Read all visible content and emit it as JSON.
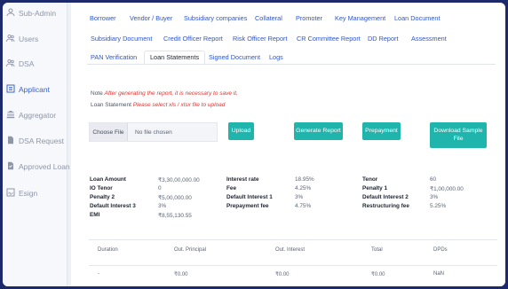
{
  "sidebar": {
    "items": [
      {
        "label": "Sub-Admin",
        "icon": "user-group-icon",
        "active": false
      },
      {
        "label": "Users",
        "icon": "users-icon",
        "active": false
      },
      {
        "label": "DSA",
        "icon": "users-icon",
        "active": false
      },
      {
        "label": "Applicant",
        "icon": "document-list-icon",
        "active": true
      },
      {
        "label": "Aggregator",
        "icon": "bank-icon",
        "active": false
      },
      {
        "label": "DSA Request",
        "icon": "file-icon",
        "active": false
      },
      {
        "label": "Approved Loan",
        "icon": "file-check-icon",
        "active": false
      },
      {
        "label": "Esign",
        "icon": "signature-icon",
        "active": false
      }
    ]
  },
  "tabs": [
    {
      "label": "Borrower"
    },
    {
      "label": "Vendor / Buyer"
    },
    {
      "label": "Subsidiary companies"
    },
    {
      "label": "Collateral"
    },
    {
      "label": "Promoter"
    },
    {
      "label": "Key Management"
    },
    {
      "label": "Loan Document"
    },
    {
      "label": "Subsidiary Document"
    },
    {
      "label": "Credit Officer Report"
    },
    {
      "label": "Risk Officer Report"
    },
    {
      "label": "CR Committee Report"
    },
    {
      "label": "DD Report"
    },
    {
      "label": "Assessment"
    },
    {
      "label": "PAN Verification"
    },
    {
      "label": "Loan Statements"
    },
    {
      "label": "Signed Document"
    },
    {
      "label": "Logs"
    }
  ],
  "active_tab": "Loan Statements",
  "notes": {
    "note_label": "Note",
    "note_text": "After generating the report, it is necessary to save it.",
    "statement_label": "Loan Statement",
    "statement_text": "Please select xls / xlsx file to upload"
  },
  "file_input": {
    "button": "Choose File",
    "status": "No file chosen"
  },
  "buttons": {
    "upload": "Upload",
    "generate": "Generate Report",
    "prepayment": "Prepayment",
    "download": "Download Sample File"
  },
  "loan_info": [
    {
      "label": "Loan Amount",
      "value": "₹3,30,00,000.00"
    },
    {
      "label": "Interest rate",
      "value": "18.95%"
    },
    {
      "label": "Tenor",
      "value": "60"
    },
    {
      "label": "IO Tenor",
      "value": "0"
    },
    {
      "label": "Fee",
      "value": "4.25%"
    },
    {
      "label": "Penalty 1",
      "value": "₹1,00,000.00"
    },
    {
      "label": "Penalty 2",
      "value": "₹5,00,000.00"
    },
    {
      "label": "Default Interest 1",
      "value": "3%"
    },
    {
      "label": "Default Interest 2",
      "value": "3%"
    },
    {
      "label": "Default Interest 3",
      "value": "3%"
    },
    {
      "label": "Prepayment fee",
      "value": "4.75%"
    },
    {
      "label": "Restructuring fee",
      "value": "5.25%"
    },
    {
      "label": "EMI",
      "value": "₹8,55,130.55"
    }
  ],
  "table": {
    "headers": [
      "Duration",
      "Out. Principal",
      "Out. Interest",
      "Total",
      "DPDs"
    ],
    "rows": [
      [
        "-",
        "₹0.00",
        "₹0.00",
        "₹0.00",
        "NaN"
      ]
    ]
  },
  "colors": {
    "accent": "#1fb5ad",
    "link": "#2f56c6",
    "warning": "#e0342f",
    "frame": "#1c2a6b"
  }
}
